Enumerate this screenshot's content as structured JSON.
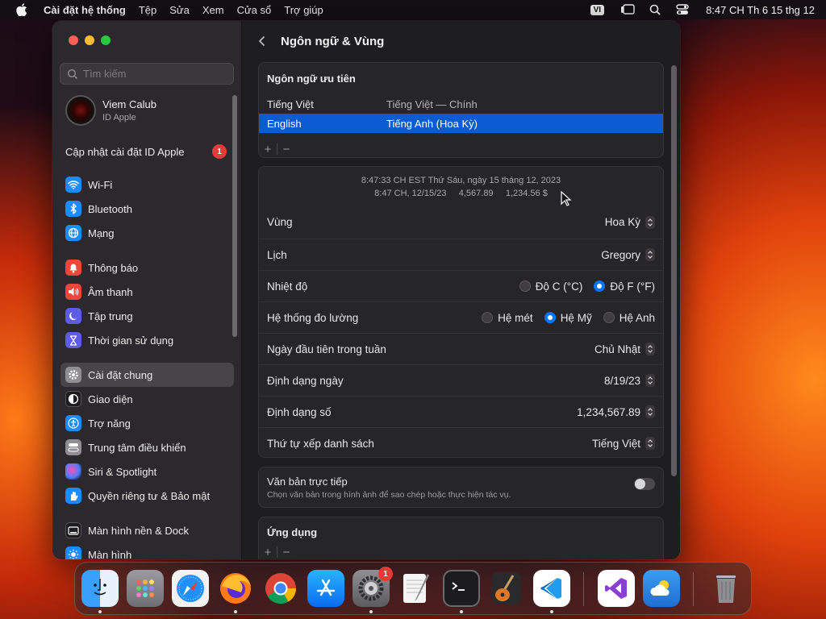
{
  "menubar": {
    "app_name": "Cài đặt hệ thống",
    "items": [
      "Tệp",
      "Sửa",
      "Xem",
      "Cửa sổ",
      "Trợ giúp"
    ],
    "input_source": "VI",
    "clock": "8:47 CH Th 6 15 thg 12"
  },
  "sidebar": {
    "search_placeholder": "Tìm kiếm",
    "profile_name": "Viem Calub",
    "profile_sub": "ID Apple",
    "update_label": "Cập nhật cài đặt ID Apple",
    "update_count": "1",
    "items": [
      {
        "label": "Wi-Fi",
        "color": "#1a8cff",
        "icon": "wifi-icon"
      },
      {
        "label": "Bluetooth",
        "color": "#1a8cff",
        "icon": "bluetooth-icon"
      },
      {
        "label": "Mạng",
        "color": "#1a8cff",
        "icon": "globe-icon"
      },
      {
        "label": "Thông báo",
        "color": "#f0453a",
        "icon": "bell-icon"
      },
      {
        "label": "Âm thanh",
        "color": "#f0453a",
        "icon": "speaker-icon"
      },
      {
        "label": "Tập trung",
        "color": "#5e5ce6",
        "icon": "moon-icon"
      },
      {
        "label": "Thời gian sử dụng",
        "color": "#5e5ce6",
        "icon": "hourglass-icon"
      },
      {
        "label": "Cài đặt chung",
        "color": "#8e8e93",
        "icon": "gear-icon"
      },
      {
        "label": "Giao diện",
        "color": "#1c1c1e",
        "icon": "appearance-icon"
      },
      {
        "label": "Trợ năng",
        "color": "#1a8cff",
        "icon": "accessibility-icon"
      },
      {
        "label": "Trung tâm điều khiển",
        "color": "#8e8e93",
        "icon": "control-center-icon"
      },
      {
        "label": "Siri & Spotlight",
        "color": "#7a3df0",
        "icon": "siri-icon"
      },
      {
        "label": "Quyền riêng tư & Bảo mật",
        "color": "#1a8cff",
        "icon": "hand-icon"
      },
      {
        "label": "Màn hình nền & Dock",
        "color": "#1c1c1e",
        "icon": "dock-icon"
      },
      {
        "label": "Màn hình",
        "color": "#1a8cff",
        "icon": "sun-icon"
      }
    ]
  },
  "main": {
    "title": "Ngôn ngữ & Vùng",
    "preferred_title": "Ngôn ngữ ưu tiên",
    "languages": [
      {
        "name": "Tiếng Việt",
        "desc": "Tiếng Việt — Chính"
      },
      {
        "name": "English",
        "desc": "Tiếng Anh (Hoa Kỳ)"
      }
    ],
    "preview_line1": "8:47:33 CH EST Thứ Sáu, ngày 15 tháng 12, 2023",
    "preview_line2": "8:47 CH, 12/15/23     4,567.89     1,234.56 $",
    "region_label": "Vùng",
    "region_value": "Hoa Kỳ",
    "calendar_label": "Lịch",
    "calendar_value": "Gregory",
    "temp_label": "Nhiệt độ",
    "temp_c": "Độ C (°C)",
    "temp_f": "Độ F (°F)",
    "measure_label": "Hệ thống đo lường",
    "measure_metric": "Hệ mét",
    "measure_us": "Hệ Mỹ",
    "measure_uk": "Hệ Anh",
    "firstday_label": "Ngày đầu tiên trong tuần",
    "firstday_value": "Chủ Nhật",
    "dateformat_label": "Định dạng ngày",
    "dateformat_value": "8/19/23",
    "numformat_label": "Định dạng số",
    "numformat_value": "1,234,567.89",
    "sort_label": "Thứ tự xếp danh sách",
    "sort_value": "Tiếng Việt",
    "livetext_label": "Văn bản trực tiếp",
    "livetext_desc": "Chọn văn bản trong hình ảnh để sao chép hoặc thực hiện tác vụ.",
    "apps_title": "Ứng dụng",
    "plus": "+",
    "minus": "−"
  },
  "dock": {
    "settings_badge": "1"
  }
}
